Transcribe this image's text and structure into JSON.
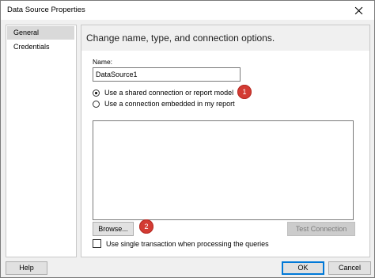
{
  "window": {
    "title": "Data Source Properties"
  },
  "sidebar": {
    "items": [
      {
        "label": "General",
        "selected": true
      },
      {
        "label": "Credentials",
        "selected": false
      }
    ]
  },
  "main": {
    "header": "Change name, type, and connection options.",
    "name_label": "Name:",
    "name_value": "DataSource1",
    "radios": [
      {
        "label": "Use a shared connection or report model",
        "checked": true
      },
      {
        "label": "Use a connection embedded in my report",
        "checked": false
      }
    ],
    "browse_label": "Browse...",
    "test_connection_label": "Test Connection",
    "single_transaction_label": "Use single transaction when processing the queries",
    "single_transaction_checked": false
  },
  "annotations": {
    "badge1": "1",
    "badge2": "2"
  },
  "footer": {
    "help_label": "Help",
    "ok_label": "OK",
    "cancel_label": "Cancel"
  },
  "colors": {
    "badge": "#d33b33",
    "default_button_border": "#0078d7"
  },
  "icons": {
    "close": "close-icon"
  }
}
